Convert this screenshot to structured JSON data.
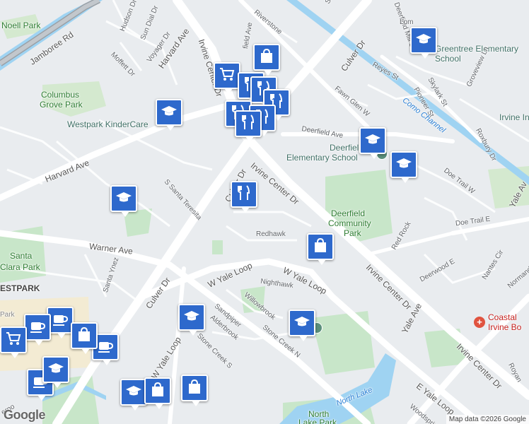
{
  "map": {
    "attribution": "Map data ©2026 Google",
    "logo": "Google",
    "labels": {
      "hudson_dr": "Hudson Dr",
      "sun_dial_dr": "Sun Dial Dr",
      "voyager_dr": "Voyager Dr",
      "moffett_dr": "Moffett Dr",
      "harvard_ave_n": "Harvard Ave",
      "harvard_ave_w": "Harvard Ave",
      "jamboree_rd": "Jamboree Rd",
      "noell_park": "Noell Park",
      "riverstone": "Riverstone",
      "field_ave": "field Ave",
      "irvine_center_dr_n": "Irvine Center Dr",
      "irvine_center_dr_mid": "Irvine Center Dr",
      "irvine_center_dr_s1": "Irvine Center Dr",
      "irvine_center_dr_s2": "Irvine Center Dr",
      "culver_dr_ne": "Culver Dr",
      "culver_dr_mid": "Culver Dr",
      "culver_dr_sw": "Culver Dr",
      "reyes_st": "Reyes St",
      "deerfield_mill_st": "Deerfield Mill St",
      "lom": "Lom",
      "su": "Su",
      "greentree_school": "Greentree Elementary School",
      "skylark_st": "Skylark St",
      "pioneer_st": "Pioneer St",
      "groveview_ln": "Groveview Ln",
      "irvine_in": "Irvine In",
      "como_channel": "Como Channel",
      "columbus_grove_park_1": "Columbus",
      "columbus_grove_park_2": "Grove Park",
      "westpark_kindercare": "Westpark KinderCare",
      "fawn_glen_w": "Fawn Glen W",
      "deerfield_ave": "Deerfield Ave",
      "deerfield_school_1": "Deerfield",
      "deerfield_school_2": "Elementary School",
      "roxbury_dr": "Roxbury Dr",
      "doe_trail_w": "Doe Trail W",
      "doe_trail_e": "Doe Trail E",
      "yale_ave_ne": "Yale Av",
      "s_santa_teresita": "S Santa Teresita",
      "redhawk": "Redhawk",
      "deerfield_park_1": "Deerfield",
      "deerfield_park_2": "Community",
      "deerfield_park_3": "Park",
      "red_rock": "Red Rock",
      "deerwood_e": "Deerwood E",
      "nantes_cir": "Nantes Cir",
      "normandie": "Normandie A",
      "warner_ave": "Warner Ave",
      "santa_clara_park_1": "Santa",
      "santa_clara_park_2": "Clara Park",
      "santa_ynez": "Santa Ynez",
      "westpark": "ESTPARK",
      "w_yale_loop_1": "W Yale Loop",
      "w_yale_loop_2": "W Yale Loop",
      "w_yale_loop_3": "W Yale Loop",
      "nighthawk": "Nighthawk",
      "willowbrook": "Willowbrook",
      "sandpiper": "Sandpiper",
      "alderbrook": "Alderbrook",
      "stone_creek_s": "Stone Creek S",
      "stone_creek_n": "Stone Creek N",
      "yale_ave": "Yale Ave",
      "coastal_1": "Coastal",
      "coastal_2": "Irvine Bo",
      "royan": "Royan",
      "e_yale_loop": "E Yale Loop",
      "woodspring": "Woodspring",
      "north_lake": "North Lake",
      "north_lake_park_1": "North",
      "north_lake_park_2": "Lake Park",
      "erno": "erno",
      "park_small": "Park"
    },
    "markers": [
      {
        "name": "school-marker-greentree",
        "icon": "graduation-cap-icon"
      },
      {
        "name": "shopping-marker-north",
        "icon": "shopping-bag-icon"
      },
      {
        "name": "grocery-marker",
        "icon": "shopping-cart-icon"
      },
      {
        "name": "restaurant-marker-1",
        "icon": "fork-knife-icon"
      },
      {
        "name": "restaurant-marker-2",
        "icon": "fork-knife-icon"
      },
      {
        "name": "restaurant-marker-3",
        "icon": "fork-knife-icon"
      },
      {
        "name": "restaurant-marker-4",
        "icon": "fork-knife-icon"
      },
      {
        "name": "restaurant-marker-5",
        "icon": "fork-knife-icon"
      },
      {
        "name": "restaurant-marker-6",
        "icon": "fork-knife-icon"
      },
      {
        "name": "school-marker-kindercare",
        "icon": "graduation-cap-icon"
      },
      {
        "name": "school-marker-deerfield",
        "icon": "graduation-cap-icon"
      },
      {
        "name": "school-marker-deerfield-east",
        "icon": "graduation-cap-icon"
      },
      {
        "name": "restaurant-marker-culver",
        "icon": "fork-knife-icon"
      },
      {
        "name": "school-marker-west",
        "icon": "graduation-cap-icon"
      },
      {
        "name": "shopping-marker-deerfield",
        "icon": "shopping-bag-icon"
      },
      {
        "name": "school-marker-sandpiper",
        "icon": "graduation-cap-icon"
      },
      {
        "name": "school-marker-stone-creek",
        "icon": "graduation-cap-icon"
      },
      {
        "name": "cafe-marker-1",
        "icon": "coffee-cup-icon"
      },
      {
        "name": "cafe-marker-2",
        "icon": "coffee-cup-icon"
      },
      {
        "name": "cafe-marker-3",
        "icon": "coffee-cup-icon"
      },
      {
        "name": "cafe-marker-4",
        "icon": "coffee-cup-icon"
      },
      {
        "name": "grocery-marker-west",
        "icon": "shopping-cart-icon"
      },
      {
        "name": "shopping-marker-westpark",
        "icon": "shopping-bag-icon"
      },
      {
        "name": "school-marker-southwest",
        "icon": "graduation-cap-icon"
      },
      {
        "name": "school-marker-south",
        "icon": "graduation-cap-icon"
      },
      {
        "name": "shopping-marker-south-1",
        "icon": "shopping-bag-icon"
      },
      {
        "name": "shopping-marker-south-2",
        "icon": "shopping-bag-icon"
      }
    ],
    "colors": {
      "land": "#e9ecef",
      "park": "#c8e6c9",
      "water": "#9fd3f2",
      "road_major": "#ffffff",
      "marker": "#2e69cc",
      "hospital": "#e0533f"
    }
  }
}
